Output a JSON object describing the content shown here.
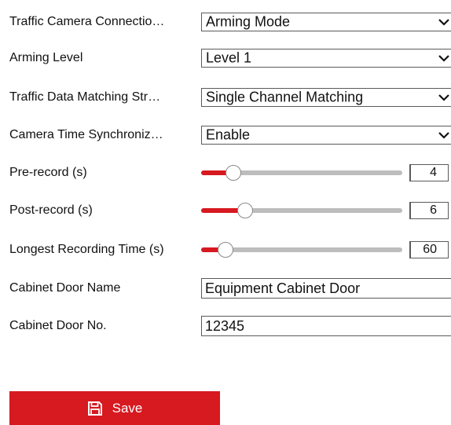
{
  "fields": {
    "traffic_camera_connection": {
      "label": "Traffic Camera Connectio…",
      "value": "Arming Mode"
    },
    "arming_level": {
      "label": "Arming Level",
      "value": "Level 1"
    },
    "traffic_data_matching": {
      "label": "Traffic Data Matching Str…",
      "value": "Single Channel Matching"
    },
    "camera_time_sync": {
      "label": "Camera Time Synchroniz…",
      "value": "Enable"
    },
    "pre_record": {
      "label": "Pre-record (s)",
      "value": "4",
      "slider_fraction": 0.16
    },
    "post_record": {
      "label": "Post-record (s)",
      "value": "6",
      "slider_fraction": 0.22
    },
    "longest_recording": {
      "label": "Longest Recording Time (s)",
      "value": "60",
      "slider_fraction": 0.12
    },
    "cabinet_door_name": {
      "label": "Cabinet Door Name",
      "value": "Equipment Cabinet Door"
    },
    "cabinet_door_no": {
      "label": "Cabinet Door No.",
      "value": "12345"
    }
  },
  "save_button": {
    "label": "Save",
    "icon": "save-icon"
  },
  "colors": {
    "accent": "#d71920",
    "track": "#bdbdbd",
    "border": "#5a5a5a"
  }
}
